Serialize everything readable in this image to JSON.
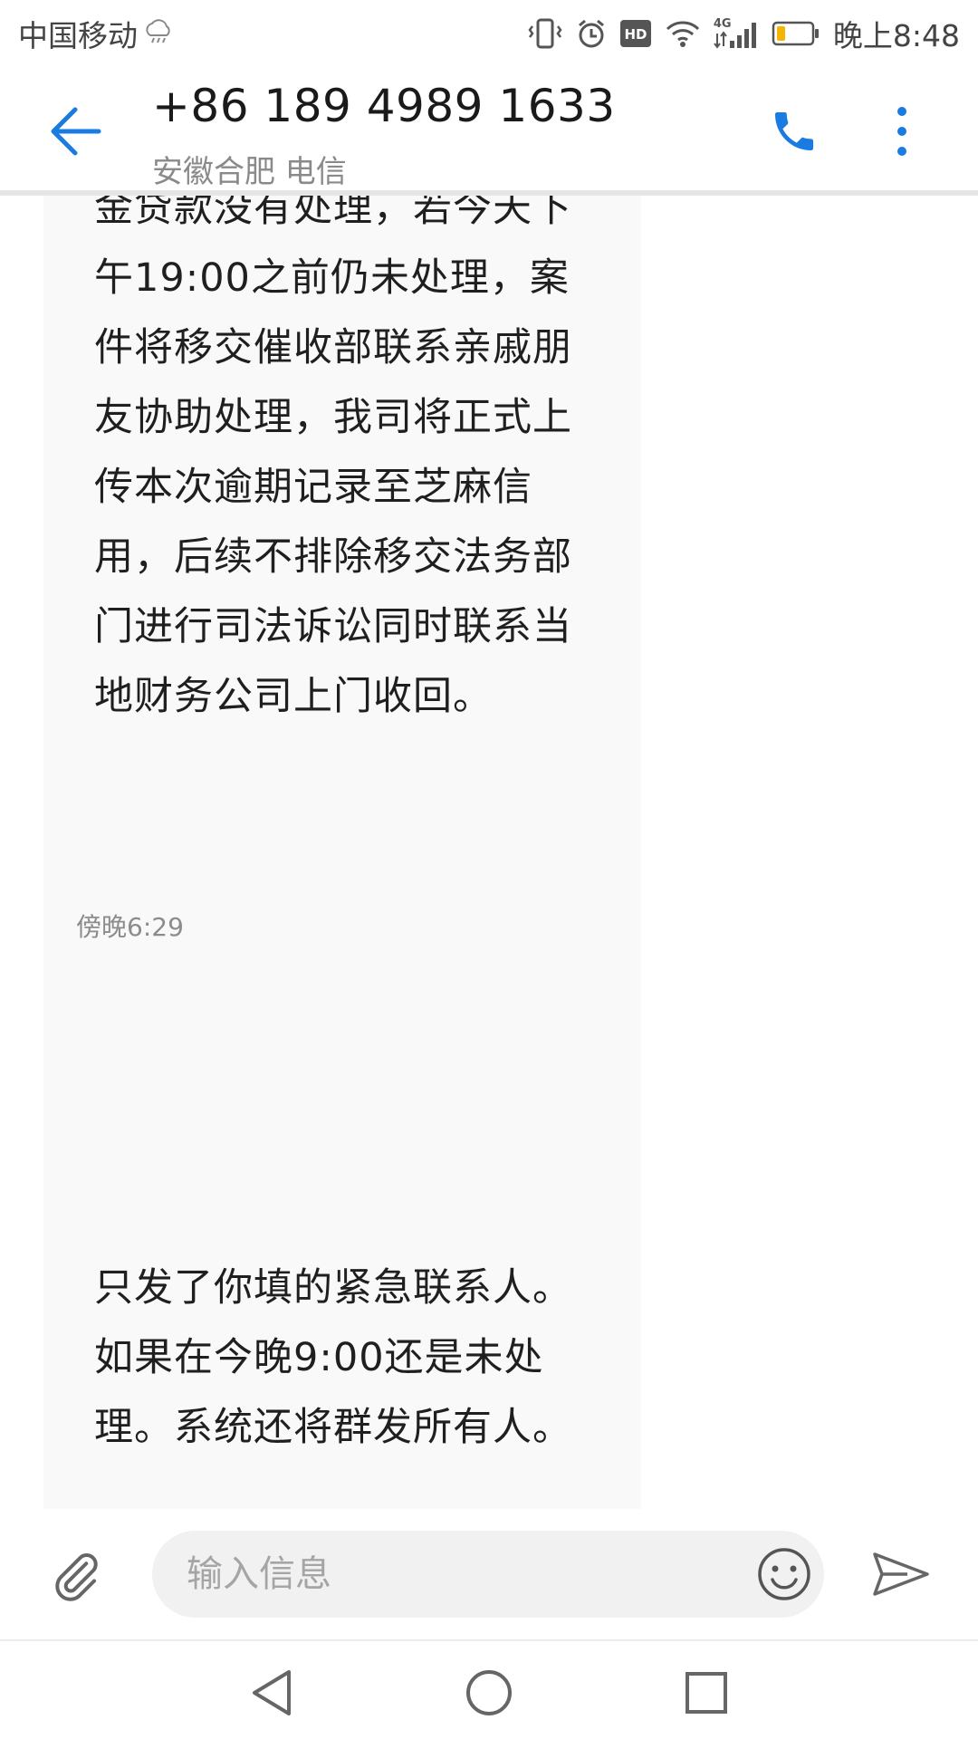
{
  "status_bar": {
    "carrier": "中国移动",
    "time": "晚上8:48",
    "network": "4G",
    "hd_label": "HD"
  },
  "header": {
    "contact_number": "+86 189 4989 1633",
    "contact_location": "安徽合肥 电信"
  },
  "messages": [
    {
      "text": "金贷款没有处理，若今天下\n午19:00之前仍未处理，案\n件将移交催收部联系亲戚朋\n友协助处理，我司将正式上\n传本次逾期记录至芝麻信\n用，后续不排除移交法务部\n门进行司法诉讼同时联系当\n地财务公司上门收回。",
      "timestamp": "傍晚6:29"
    },
    {
      "text": "只发了你填的紧急联系人。\n如果在今晚9:00还是未处\n理。系统还将群发所有人。"
    }
  ],
  "composer": {
    "placeholder": "输入信息"
  },
  "colors": {
    "accent": "#1a7be0",
    "bubble": "#f9f9f9",
    "battery_low": "#f5b400"
  }
}
